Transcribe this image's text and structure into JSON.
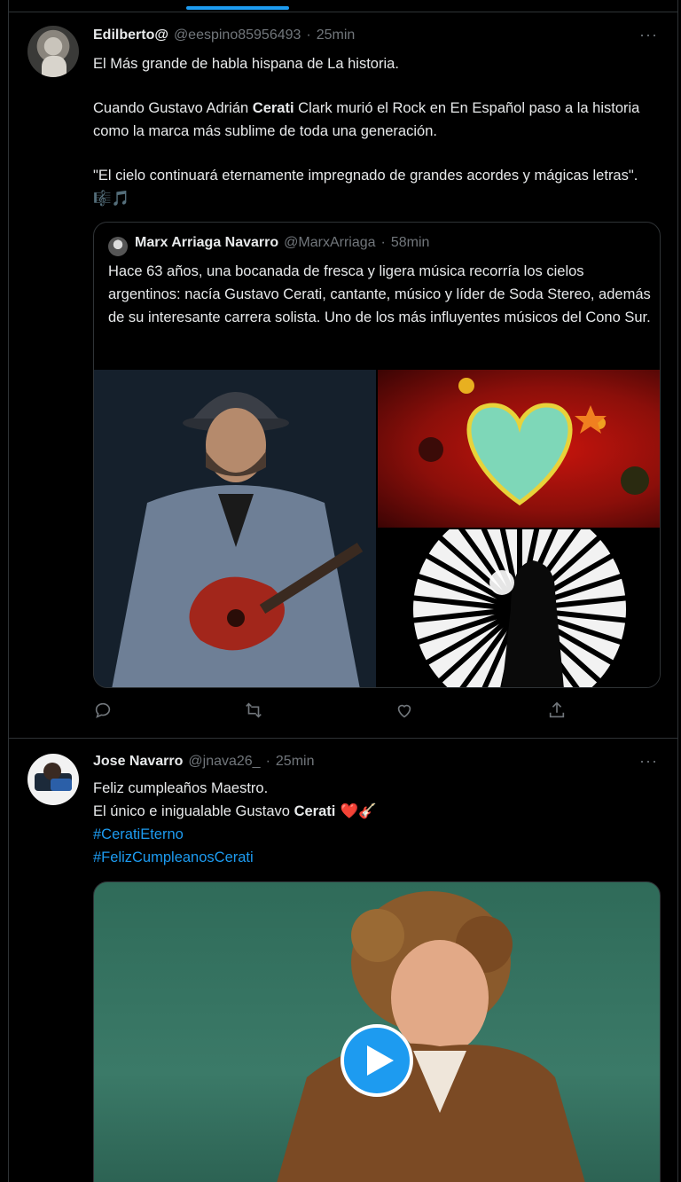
{
  "tweets": [
    {
      "name": "Edilberto@",
      "handle": "@eespino85956493",
      "separator": "·",
      "time": "25min",
      "text_line1": "El Más grande de habla hispana de La historia.",
      "text_p2_a": "Cuando Gustavo Adrián ",
      "text_p2_bold": "Cerati",
      "text_p2_b": " Clark murió el Rock en En Español paso a la historia como la marca más sublime de toda una generación.",
      "text_p3": "\"El cielo continuará eternamente impregnado de grandes  acordes y mágicas letras\".",
      "text_p3_emoji": " 🎼🎵",
      "quote": {
        "name": "Marx Arriaga Navarro",
        "handle": "@MarxArriaga",
        "separator": "·",
        "time": "58min",
        "text": "Hace 63 años, una bocanada de fresca y ligera música recorría los cielos argentinos: nacía Gustavo Cerati, cantante, músico y líder de Soda Stereo, además de su interesante carrera solista. Uno de los más influyentes músicos del Cono Sur."
      }
    },
    {
      "name": "Jose Navarro",
      "handle": "@jnava26_",
      "separator": "·",
      "time": "25min",
      "line1": "Feliz cumpleaños Maestro.",
      "line2_a": "El único e inigualable Gustavo ",
      "line2_bold": "Cerati",
      "line2_emoji": " ❤️🎸",
      "hashtags": [
        "#CeratiEterno",
        "#FelizCumpleanosCerati"
      ]
    }
  ],
  "more_label": "···",
  "colors": {
    "accent": "#1d9bf0",
    "background": "#000000",
    "border": "#2f3336",
    "muted": "#71767b"
  },
  "icons": [
    "reply-icon",
    "retweet-icon",
    "like-icon",
    "share-icon",
    "play-icon"
  ]
}
